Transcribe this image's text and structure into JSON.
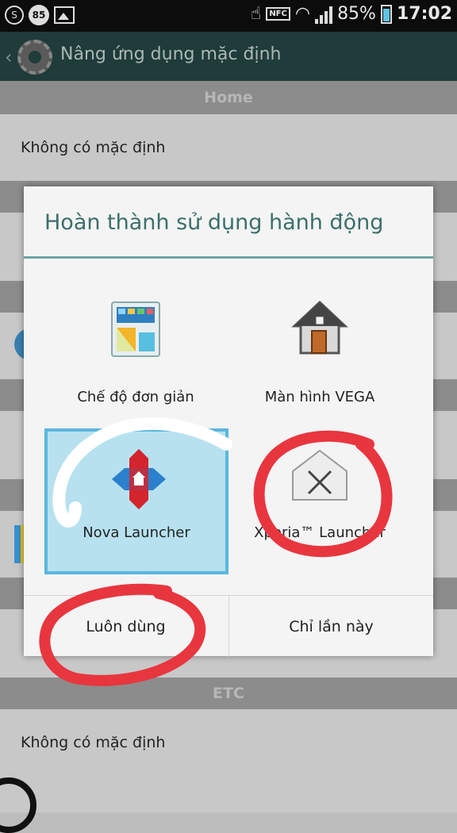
{
  "status_bar": {
    "badge": "85",
    "battery": "85%",
    "time": "17:02",
    "nfc": "NFC"
  },
  "action_bar": {
    "title": "Nâng ứng dụng mặc định"
  },
  "list": {
    "section_home": "Home",
    "row_home": "Không có mặc định",
    "section_etc": "ETC",
    "row_etc": "Không có mặc định"
  },
  "dialog": {
    "title": "Hoàn thành sử dụng hành động",
    "apps": [
      {
        "label": "Chế độ đơn giản",
        "icon": "simple-mode-icon"
      },
      {
        "label": "Màn hình VEGA",
        "icon": "house-icon"
      },
      {
        "label": "Nova Launcher",
        "icon": "nova-launcher-icon"
      },
      {
        "label": "Xperia™ Launcher",
        "icon": "xperia-launcher-icon"
      }
    ],
    "buttons": {
      "always": "Luôn dùng",
      "just_once": "Chỉ lần này"
    }
  },
  "colors": {
    "accent": "#3b6f6b",
    "selected_bg": "#b7e1ef",
    "selected_border": "#5ab7de",
    "annotation_red": "#e8363f"
  }
}
